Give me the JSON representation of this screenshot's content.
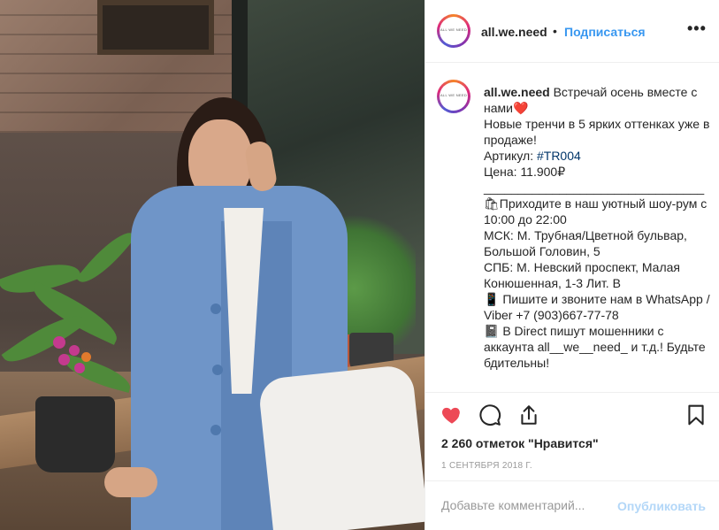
{
  "header": {
    "avatar_text": "ALL WE NEED",
    "username": "all.we.need",
    "dot": "•",
    "follow_label": "Подписаться",
    "more_label": "•••"
  },
  "caption": {
    "avatar_text": "ALL WE NEED",
    "username": "all.we.need",
    "line1": " Встречай осень вместе с нами❤️",
    "line2": "Новые тренчи в 5 ярких оттенках уже в продаже!",
    "sku_label": "Артикул: ",
    "sku_tag": "#TR004",
    "price": "Цена: 11.900₽",
    "divider": "________________________________",
    "showroom": "🛍Приходите в наш уютный шоу-рум с 10:00 до 22:00",
    "msk": "МСК: М. Трубная/Цветной бульвар, Большой Головин, 5",
    "spb": "СПБ: М. Невский проспект, Малая Конюшенная, 1-3 Лит. В",
    "contact": "📱 Пишите и звоните нам в WhatsApp / Viber +7 (903)667-77-78",
    "warning": "📓 В Direct пишут мошенники с аккаунта all__we__need_ и т.д.! Будьте бдительны!"
  },
  "actions": {
    "like_icon": "heart-icon",
    "comment_icon": "comment-icon",
    "share_icon": "share-icon",
    "save_icon": "bookmark-icon",
    "like_color": "#ed4956"
  },
  "likes_text": "2 260 отметок \"Нравится\"",
  "date_text": "1 сентября 2018 г.",
  "add_comment": {
    "placeholder": "Добавьте комментарий...",
    "publish_label": "Опубликовать"
  },
  "colors": {
    "link_blue": "#3897f0",
    "hashtag": "#003569",
    "publish_disabled": "#b3d7f8"
  }
}
